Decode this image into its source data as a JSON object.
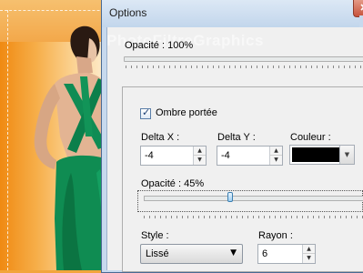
{
  "dialog": {
    "title": "Options",
    "watermark": "PhotoFiltreGraphics",
    "opacity_label": "Opacité : 100%",
    "shadow": {
      "checkbox_label": "Ombre portée",
      "checked": true,
      "delta_x_label": "Delta X :",
      "delta_x_value": "-4",
      "delta_y_label": "Delta Y :",
      "delta_y_value": "-4",
      "color_label": "Couleur :",
      "color_value": "#000000",
      "opacity_label": "Opacité : 45%",
      "opacity_fraction": 0.45,
      "style_label": "Style :",
      "style_value": "Lissé",
      "radius_label": "Rayon :",
      "radius_value": "6"
    }
  },
  "colors": {
    "accent": "#3c7fb1",
    "background_orange": "#f08a12",
    "dress_green": "#0f8c52"
  },
  "icons": {
    "close": "close-icon",
    "spin_up": "chevron-up-icon",
    "spin_down": "chevron-down-icon",
    "dropdown": "chevron-down-icon",
    "check": "checkmark-icon"
  }
}
